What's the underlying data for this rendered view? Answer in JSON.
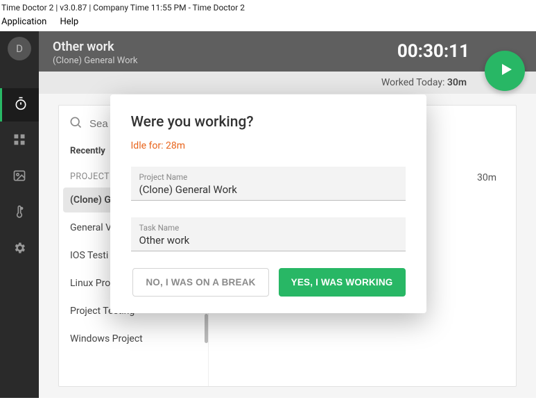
{
  "window": {
    "title": "Time Doctor 2 | v3.0.87 | Company Time 11:55 PM - Time Doctor 2"
  },
  "menu": {
    "application": "Application",
    "help": "Help"
  },
  "avatar": {
    "initial": "D"
  },
  "header": {
    "task": "Other work",
    "project": "(Clone) General Work",
    "timer": "00:30:11",
    "worked_label": "Worked Today: ",
    "worked_value": "30m"
  },
  "search": {
    "placeholder": "Sea"
  },
  "sections": {
    "recent": "Recently",
    "projects": "PROJECT"
  },
  "projects": [
    "(Clone) G",
    "General V",
    "IOS Testi",
    "Linux Pro",
    "Project Testing",
    "Windows Project"
  ],
  "task_duration": "30m",
  "modal": {
    "title": "Were you working?",
    "idle": "Idle for: 28m",
    "project_label": "Project Name",
    "project_value": "(Clone) General Work",
    "task_label": "Task Name",
    "task_value": "Other work",
    "break_btn": "NO, I WAS ON A BREAK",
    "working_btn": "YES, I WAS WORKING"
  }
}
